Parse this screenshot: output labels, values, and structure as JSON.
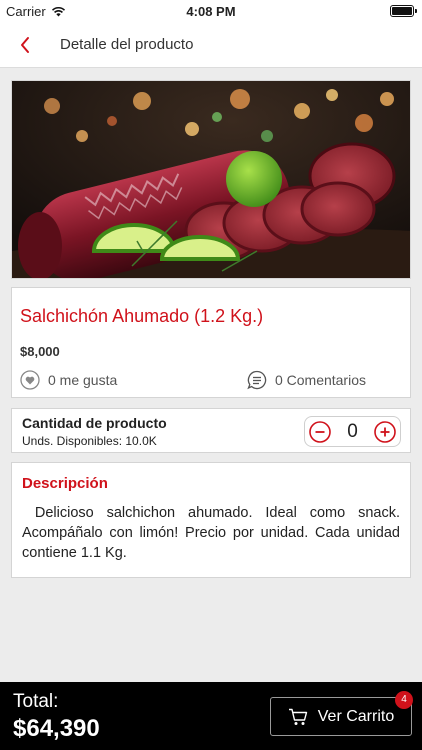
{
  "status_bar": {
    "carrier": "Carrier",
    "time": "4:08 PM"
  },
  "nav": {
    "back_icon": "chevron-left-icon",
    "title": "Detalle del producto"
  },
  "product": {
    "name": "Salchichón Ahumado (1.2 Kg.)",
    "price": "$8,000",
    "likes": "0 me gusta",
    "comments": "0 Comentarios"
  },
  "quantity": {
    "title": "Cantidad de producto",
    "available": "Unds. Disponibles: 10.0K",
    "value": "0"
  },
  "description": {
    "title": "Descripción",
    "text": " Delicioso salchichon ahumado. Ideal como snack. Acompáñalo con limón! Precio por unidad. Cada unidad contiene 1.1 Kg."
  },
  "bottom_bar": {
    "total_label": "Total:",
    "total_value": "$64,390",
    "cart_label": "Ver Carrito",
    "cart_badge": "4"
  },
  "colors": {
    "accent": "#d0121b",
    "bottom_bar": "#000000",
    "background": "#ececec"
  }
}
